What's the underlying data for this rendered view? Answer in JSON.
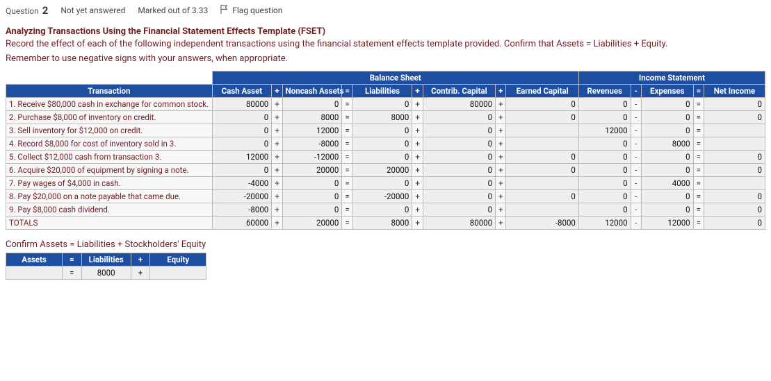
{
  "header": {
    "question_label": "Question",
    "question_number": "2",
    "status": "Not yet answered",
    "marked": "Marked out of 3.33",
    "flag": "Flag question"
  },
  "intro": {
    "title": "Analyzing Transactions Using the Financial Statement Effects Template (FSET)",
    "line": "Record the effect of each of the following independent transactions using the financial statement effects template provided. Confirm that Assets = Liabilities + Equity.",
    "reminder": "Remember to use negative signs with your answers, when appropriate."
  },
  "groups": {
    "bs": "Balance Sheet",
    "is": "Income Statement"
  },
  "cols": {
    "tx": "Transaction",
    "cash": "Cash Asset",
    "noncash": "Noncash Assets",
    "liab": "Liabilities",
    "cc": "Contrib. Capital",
    "ec": "Earned Capital",
    "rev": "Revenues",
    "exp": "Expenses",
    "ni": "Net Income"
  },
  "ops": {
    "plus": "+",
    "eq": "=",
    "minus": "-"
  },
  "rows": [
    {
      "desc": "1. Receive $80,000 cash in exchange for common stock.",
      "cash": "80000",
      "noncash": "0",
      "liab": "0",
      "cc": "80000",
      "ec": "0",
      "rev": "0",
      "exp": "0",
      "ni": "0"
    },
    {
      "desc": "2. Purchase $8,000 of inventory on credit.",
      "cash": "0",
      "noncash": "8000",
      "liab": "8000",
      "cc": "0",
      "ec": "0",
      "rev": "0",
      "exp": "0",
      "ni": "0"
    },
    {
      "desc": "3. Sell inventory for $12,000 on credit.",
      "cash": "0",
      "noncash": "12000",
      "liab": "0",
      "cc": "0",
      "ec": "",
      "rev": "12000",
      "exp": "0",
      "ni": ""
    },
    {
      "desc": "4. Record $8,000 for cost of inventory sold in 3.",
      "cash": "0",
      "noncash": "-8000",
      "liab": "0",
      "cc": "0",
      "ec": "",
      "rev": "0",
      "exp": "8000",
      "ni": ""
    },
    {
      "desc": "5. Collect $12,000 cash from transaction 3.",
      "cash": "12000",
      "noncash": "-12000",
      "liab": "0",
      "cc": "0",
      "ec": "0",
      "rev": "0",
      "exp": "0",
      "ni": "0"
    },
    {
      "desc": "6. Acquire $20,000 of equipment by signing a note.",
      "cash": "0",
      "noncash": "20000",
      "liab": "20000",
      "cc": "0",
      "ec": "0",
      "rev": "0",
      "exp": "0",
      "ni": "0"
    },
    {
      "desc": "7. Pay wages of $4,000 in cash.",
      "cash": "-4000",
      "noncash": "0",
      "liab": "0",
      "cc": "0",
      "ec": "",
      "rev": "0",
      "exp": "4000",
      "ni": ""
    },
    {
      "desc": "8. Pay $20,000 on a note payable that came due.",
      "cash": "-20000",
      "noncash": "0",
      "liab": "-20000",
      "cc": "0",
      "ec": "0",
      "rev": "0",
      "exp": "0",
      "ni": "0"
    },
    {
      "desc": "9. Pay $8,000 cash dividend.",
      "cash": "-8000",
      "noncash": "0",
      "liab": "0",
      "cc": "0",
      "ec": "",
      "rev": "0",
      "exp": "0",
      "ni": "0"
    }
  ],
  "totals": {
    "label": "TOTALS",
    "cash": "60000",
    "noncash": "20000",
    "liab": "8000",
    "cc": "80000",
    "ec": "-8000",
    "rev": "12000",
    "exp": "12000",
    "ni": "0"
  },
  "confirm": {
    "label": "Confirm Assets = Liabilities + Stockholders' Equity",
    "headers": {
      "assets": "Assets",
      "liab": "Liabilities",
      "equity": "Equity"
    },
    "assets": "",
    "liab": "8000",
    "equity": ""
  }
}
